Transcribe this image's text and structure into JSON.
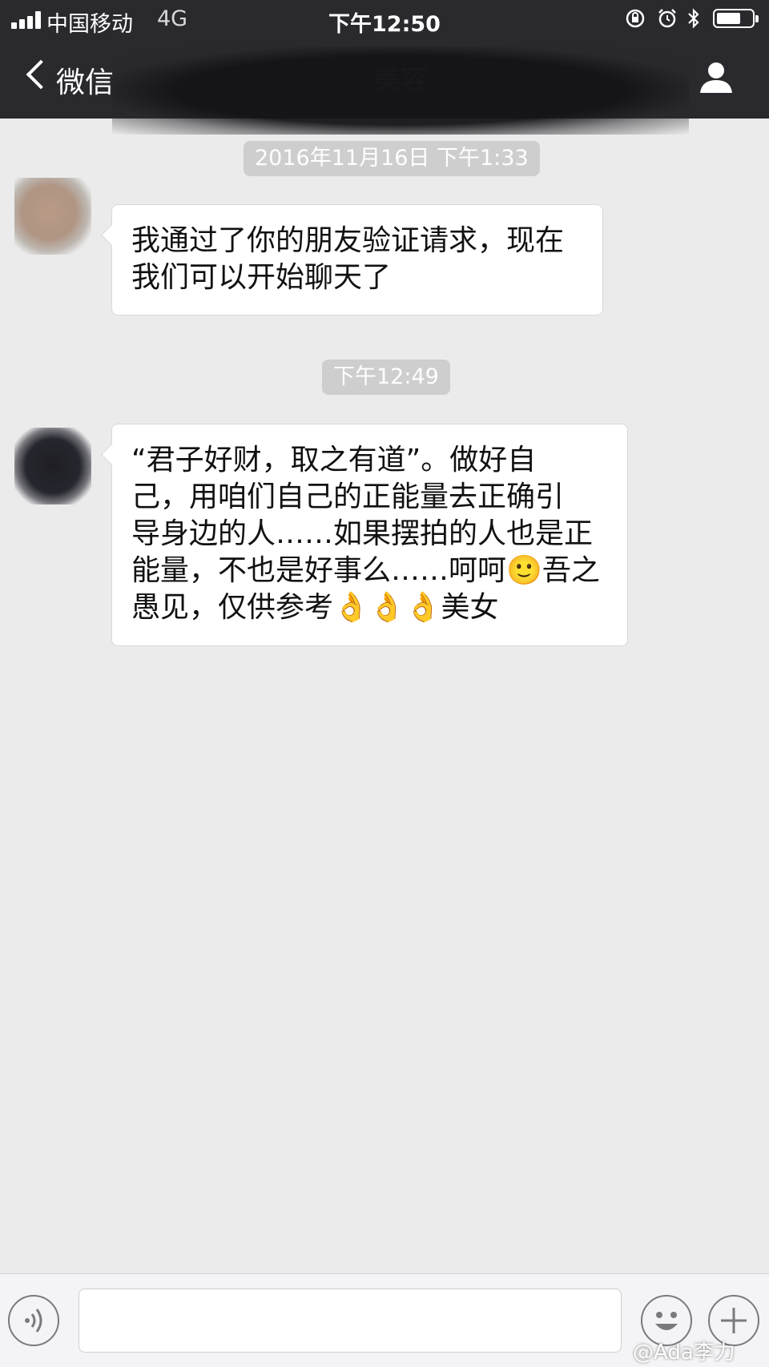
{
  "status_bar": {
    "carrier": "中国移动",
    "network": "4G",
    "time": "下午12:50",
    "battery_level": 0.7,
    "icons": [
      "signal-icon",
      "orientation-lock-icon",
      "alarm-icon",
      "bluetooth-icon",
      "battery-icon"
    ]
  },
  "nav": {
    "back_label": "微信",
    "title": "美容",
    "icons": [
      "back-chevron-icon",
      "profile-icon"
    ]
  },
  "messages": [
    {
      "timestamp": "2016年11月16日 下午1:33",
      "text": "我通过了你的朋友验证请求，现在\n我们可以开始聊天了"
    },
    {
      "timestamp": "下午12:49",
      "text": "“君子好财，取之有道”。做好自\n己，用咱们自己的正能量去正确引\n导身边的人……如果摆拍的人也是正\n能量，不也是好事么……呵呵🙂吾之\n愚见，仅供参考👌👌👌美女"
    }
  ],
  "input_bar": {
    "icons": [
      "voice-icon",
      "emoji-icon",
      "plus-icon"
    ]
  },
  "watermark": "@Ada李力",
  "colors": {
    "bar_background": "#2a2a2e",
    "chat_background": "#ebebeb",
    "timestamp_background": "#cecece",
    "bubble_background": "#ffffff"
  }
}
